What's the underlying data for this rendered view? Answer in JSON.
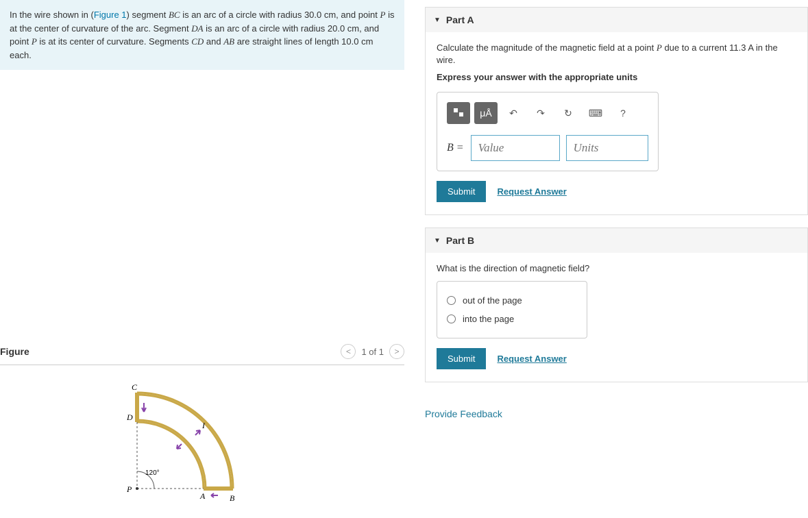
{
  "problem": {
    "text_prefix": "In the wire shown in (",
    "figure_link": "Figure 1",
    "text_body": ") segment BC is an arc of a circle with radius 30.0 cm, and point P is at the center of curvature of the arc. Segment DA is an arc of a circle with radius 20.0 cm, and point P is at its center of curvature. Segments CD and AB are straight lines of length 10.0 cm each."
  },
  "figure": {
    "title": "Figure",
    "nav_text": "1 of 1",
    "angle_label": "120°",
    "label_C": "C",
    "label_D": "D",
    "label_A": "A",
    "label_B": "B",
    "label_P": "P",
    "label_I": "I"
  },
  "partA": {
    "title": "Part A",
    "question": "Calculate the magnitude of the magnetic field at a point P due to a current 11.3  A in the wire.",
    "instruction": "Express your answer with the appropriate units",
    "eq_label": "B =",
    "value_placeholder": "Value",
    "units_placeholder": "Units",
    "submit": "Submit",
    "request": "Request Answer"
  },
  "partB": {
    "title": "Part B",
    "question": "What is the direction of magnetic field?",
    "option1": "out of the page",
    "option2": "into the page",
    "submit": "Submit",
    "request": "Request Answer"
  },
  "feedback": "Provide Feedback",
  "icons": {
    "mu_a": "μÅ",
    "help": "?"
  }
}
